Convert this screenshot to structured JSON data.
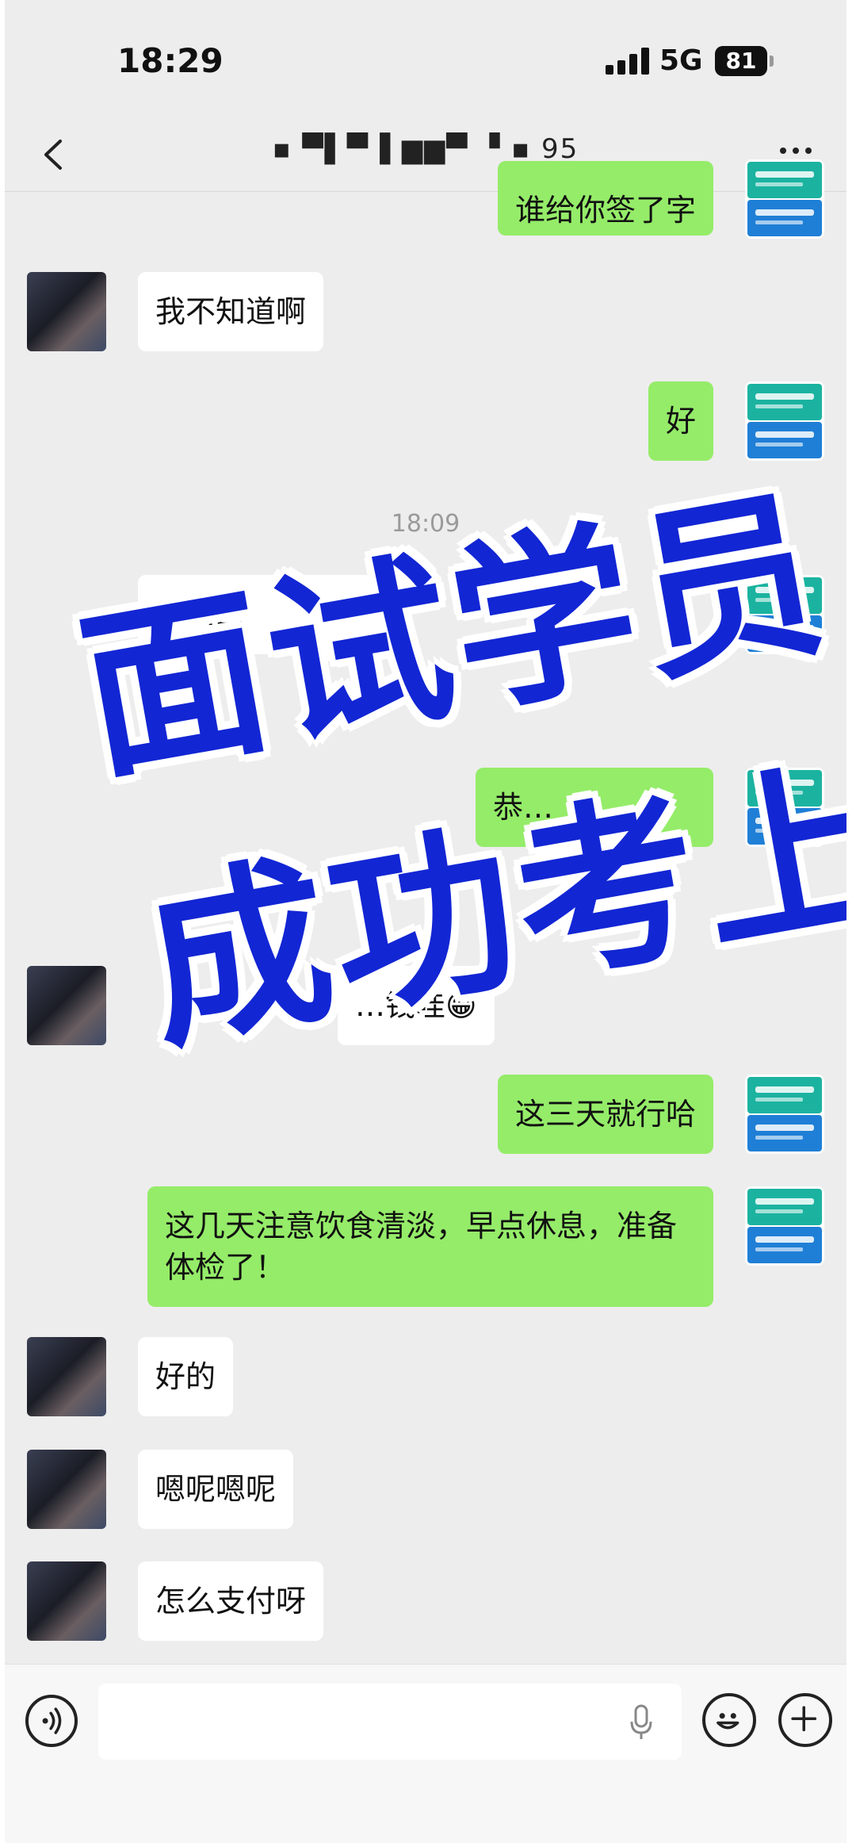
{
  "status_bar": {
    "time": "18:29",
    "network": "5G",
    "battery": "81"
  },
  "nav": {
    "title": "▪ ▀▌▀▐ ▆▆▀ ▝ ▪ 95"
  },
  "messages": [
    {
      "side": "right",
      "text": "谁给你签了字"
    },
    {
      "side": "left",
      "text": "我不知道啊"
    },
    {
      "side": "right",
      "text": "好"
    },
    {
      "type": "time",
      "text": "18:09"
    },
    {
      "side": "left",
      "text": "附…2:"
    },
    {
      "side": "right",
      "text": "恭…"
    },
    {
      "side": "left",
      "text": "…钱哇😁"
    },
    {
      "side": "right",
      "text": "这三天就行哈"
    },
    {
      "side": "right",
      "text": "这几天注意饮食清淡，早点休息，准备体检了！"
    },
    {
      "side": "left",
      "text": "好的"
    },
    {
      "side": "left",
      "text": "嗯呢嗯呢"
    },
    {
      "side": "left",
      "text": "怎么支付呀"
    }
  ],
  "overlay": {
    "line1": "面试学员",
    "line2": "成功考上"
  },
  "colors": {
    "overlay_text": "#1226d4",
    "bubble_sent": "#95ec69",
    "bubble_received": "#ffffff",
    "chat_bg": "#ededed"
  },
  "icons": [
    "back-chevron-icon",
    "more-dots-icon",
    "voice-icon",
    "microphone-icon",
    "emoji-icon",
    "plus-icon"
  ]
}
